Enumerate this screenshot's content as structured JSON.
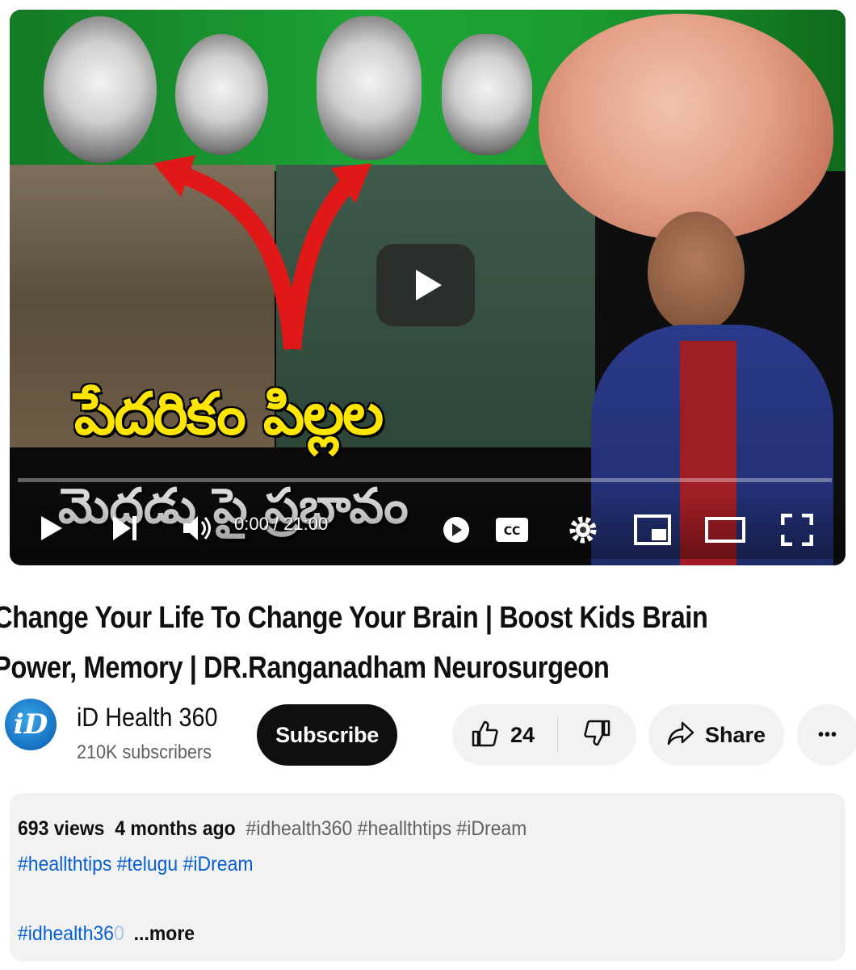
{
  "player": {
    "overlay_title": "పేదరికం పిల్లల",
    "overlay_subtitle": "మెదడు పై ప్రభావం",
    "time_display": "0:00 / 21:00",
    "progress_fraction": 0.0,
    "cc_label": "CC"
  },
  "video": {
    "title": "Change Your Life To Change Your Brain | Boost Kids Brain Power, Memory | DR.Ranganadham Neurosurgeon"
  },
  "channel": {
    "name": "iD Health 360",
    "subscribers": "210K subscribers",
    "avatar_text": "iD",
    "subscribe_label": "Subscribe"
  },
  "actions": {
    "like_count": "24",
    "share_label": "Share",
    "more_label": "•••"
  },
  "description": {
    "views": "693 views",
    "ago": "4 months ago",
    "inline_tags": [
      "#idhealth360",
      "#heallthtips",
      "#iDream"
    ],
    "tags_line2": [
      "#heallthtips",
      "#telugu",
      "#iDream"
    ],
    "tag_line3": "#idhealth36",
    "tag_line3_fade": "0",
    "more_label": "...more"
  },
  "colors": {
    "accent_link": "#065fd4",
    "subscribe_bg": "#0f0f0f",
    "pill_bg": "#f2f2f2",
    "overlay_title_color": "#ffe600"
  }
}
